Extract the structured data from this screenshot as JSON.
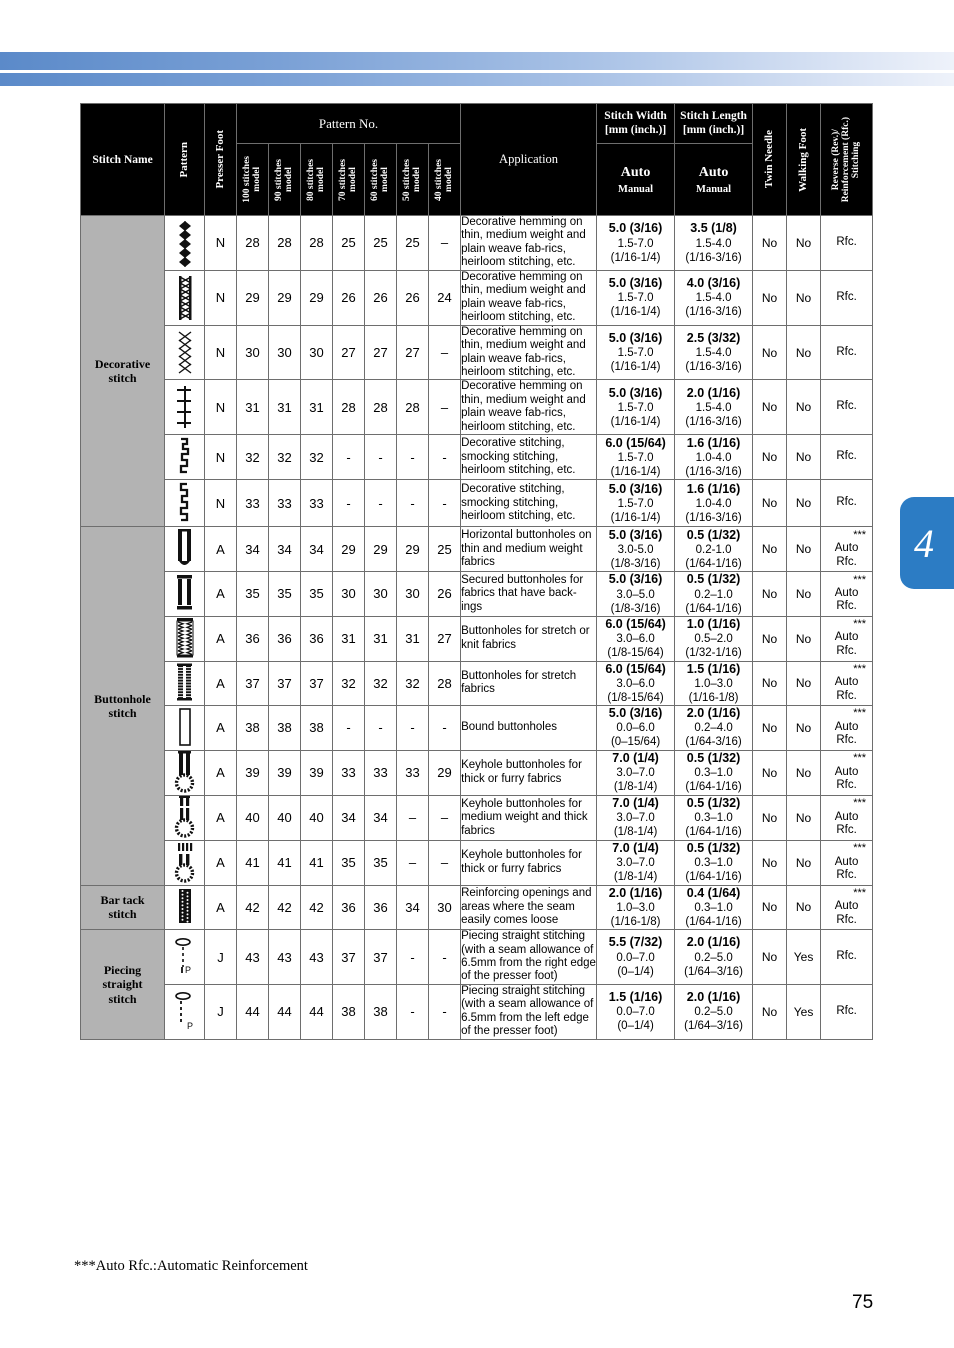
{
  "page": {
    "number": "75",
    "chapter_tab": "4",
    "footnote": "***Auto Rfc.:Automatic Reinforcement",
    "accent_color": "#2c7cc4",
    "header_bg": "#000000",
    "category_bg": "#b3b3b3"
  },
  "header": {
    "stitch_name": "Stitch Name",
    "pattern": "Pattern",
    "presser_foot": "Presser Foot",
    "pattern_no": "Pattern No.",
    "models": [
      "100 stitches\nmodel",
      "90 stitches\nmodel",
      "80 stitches\nmodel",
      "70 stitches\nmodel",
      "60 stitches\nmodel",
      "50 stitches\nmodel",
      "40 stitches\nmodel"
    ],
    "application": "Application",
    "stitch_width": "Stitch Width\n[mm (inch.)]",
    "stitch_length": "Stitch Length\n[mm (inch.)]",
    "auto": "Auto",
    "manual": "Manual",
    "twin_needle": "Twin Needle",
    "walking_foot": "Walking Foot",
    "reverse": "Reverse (Rev.)/\nReinforcement (Rfc.)\nStitching"
  },
  "categories": [
    {
      "name": "Decorative\nstitch",
      "rows": 6
    },
    {
      "name": "Buttonhole\nstitch",
      "rows": 8
    },
    {
      "name": "Bar tack\nstitch",
      "rows": 1
    },
    {
      "name": "Piecing\nstraight\nstitch",
      "rows": 2
    }
  ],
  "rows": [
    {
      "pattern_icon": "decorative-diamond-chain-stitch-icon",
      "presser_foot": "N",
      "numbers": [
        "28",
        "28",
        "28",
        "25",
        "25",
        "25",
        "–"
      ],
      "application": "Decorative hemming on thin, medium weight and plain weave fab-rics, heirloom stitching, etc.",
      "width_auto": "5.0 (3/16)",
      "width_range": "1.5-7.0",
      "width_inch": "(1/16-1/4)",
      "length_auto": "3.5 (1/8)",
      "length_range": "1.5-4.0",
      "length_inch": "(1/16-3/16)",
      "twin_needle": "No",
      "walking_foot": "No",
      "reverse": "Rfc.",
      "stars": ""
    },
    {
      "pattern_icon": "decorative-ladder-zigzag-stitch-icon",
      "presser_foot": "N",
      "numbers": [
        "29",
        "29",
        "29",
        "26",
        "26",
        "26",
        "24"
      ],
      "application": "Decorative hemming on thin, medium weight and plain weave fab-rics, heirloom stitching, etc.",
      "width_auto": "5.0 (3/16)",
      "width_range": "1.5-7.0",
      "width_inch": "(1/16-1/4)",
      "length_auto": "4.0 (3/16)",
      "length_range": "1.5-4.0",
      "length_inch": "(1/16-3/16)",
      "twin_needle": "No",
      "walking_foot": "No",
      "reverse": "Rfc.",
      "stars": ""
    },
    {
      "pattern_icon": "decorative-crosshatch-stitch-icon",
      "presser_foot": "N",
      "numbers": [
        "30",
        "30",
        "30",
        "27",
        "27",
        "27",
        "–"
      ],
      "application": "Decorative hemming on thin, medium weight and plain weave fab-rics, heirloom stitching, etc.",
      "width_auto": "5.0 (3/16)",
      "width_range": "1.5-7.0",
      "width_inch": "(1/16-1/4)",
      "length_auto": "2.5 (3/32)",
      "length_range": "1.5-4.0",
      "length_inch": "(1/16-3/16)",
      "twin_needle": "No",
      "walking_foot": "No",
      "reverse": "Rfc.",
      "stars": ""
    },
    {
      "pattern_icon": "decorative-crossbar-stitch-icon",
      "presser_foot": "N",
      "numbers": [
        "31",
        "31",
        "31",
        "28",
        "28",
        "28",
        "–"
      ],
      "application": "Decorative hemming on thin, medium weight and plain weave fab-rics, heirloom stitching, etc.",
      "width_auto": "5.0 (3/16)",
      "width_range": "1.5-7.0",
      "width_inch": "(1/16-1/4)",
      "length_auto": "2.0 (1/16)",
      "length_range": "1.5-4.0",
      "length_inch": "(1/16-3/16)",
      "twin_needle": "No",
      "walking_foot": "No",
      "reverse": "Rfc.",
      "stars": ""
    },
    {
      "pattern_icon": "decorative-step-wave-stitch-icon",
      "presser_foot": "N",
      "numbers": [
        "32",
        "32",
        "32",
        "-",
        "-",
        "-",
        "-"
      ],
      "application": "Decorative stitching, smocking stitching, heirloom stitching, etc.",
      "width_auto": "6.0 (15/64)",
      "width_range": "1.5-7.0",
      "width_inch": "(1/16-1/4)",
      "length_auto": "1.6 (1/16)",
      "length_range": "1.0-4.0",
      "length_inch": "(1/16-3/16)",
      "twin_needle": "No",
      "walking_foot": "No",
      "reverse": "Rfc.",
      "stars": ""
    },
    {
      "pattern_icon": "decorative-step-wave-alt-stitch-icon",
      "presser_foot": "N",
      "numbers": [
        "33",
        "33",
        "33",
        "-",
        "-",
        "-",
        "-"
      ],
      "application": "Decorative stitching, smocking stitching, heirloom stitching, etc.",
      "width_auto": "5.0 (3/16)",
      "width_range": "1.5-7.0",
      "width_inch": "(1/16-1/4)",
      "length_auto": "1.6 (1/16)",
      "length_range": "1.0-4.0",
      "length_inch": "(1/16-3/16)",
      "twin_needle": "No",
      "walking_foot": "No",
      "reverse": "Rfc.",
      "stars": ""
    },
    {
      "pattern_icon": "horizontal-buttonhole-icon",
      "presser_foot": "A",
      "numbers": [
        "34",
        "34",
        "34",
        "29",
        "29",
        "29",
        "25"
      ],
      "application": "Horizontal buttonholes on thin and medium weight fabrics",
      "width_auto": "5.0 (3/16)",
      "width_range": "3.0-5.0",
      "width_inch": "(1/8-3/16)",
      "length_auto": "0.5 (1/32)",
      "length_range": "0.2-1.0",
      "length_inch": "(1/64-1/16)",
      "twin_needle": "No",
      "walking_foot": "No",
      "reverse": "Auto\nRfc.",
      "stars": "***"
    },
    {
      "pattern_icon": "secured-buttonhole-icon",
      "presser_foot": "A",
      "numbers": [
        "35",
        "35",
        "35",
        "30",
        "30",
        "30",
        "26"
      ],
      "application": "Secured buttonholes for fabrics that have back-ings",
      "width_auto": "5.0 (3/16)",
      "width_range": "3.0–5.0",
      "width_inch": "(1/8-3/16)",
      "length_auto": "0.5 (1/32)",
      "length_range": "0.2–1.0",
      "length_inch": "(1/64-1/16)",
      "twin_needle": "No",
      "walking_foot": "No",
      "reverse": "Auto\nRfc.",
      "stars": "***"
    },
    {
      "pattern_icon": "stretch-buttonhole-icon",
      "presser_foot": "A",
      "numbers": [
        "36",
        "36",
        "36",
        "31",
        "31",
        "31",
        "27"
      ],
      "application": "Buttonholes for stretch or knit fabrics",
      "width_auto": "6.0 (15/64)",
      "width_range": "3.0–6.0",
      "width_inch": "(1/8-15/64)",
      "length_auto": "1.0 (1/16)",
      "length_range": "0.5–2.0",
      "length_inch": "(1/32-1/16)",
      "twin_needle": "No",
      "walking_foot": "No",
      "reverse": "Auto\nRfc.",
      "stars": "***"
    },
    {
      "pattern_icon": "stretch-fabric-buttonhole-icon",
      "presser_foot": "A",
      "numbers": [
        "37",
        "37",
        "37",
        "32",
        "32",
        "32",
        "28"
      ],
      "application": "Buttonholes for stretch fabrics",
      "width_auto": "6.0 (15/64)",
      "width_range": "3.0–6.0",
      "width_inch": "(1/8-15/64)",
      "length_auto": "1.5 (1/16)",
      "length_range": "1.0–3.0",
      "length_inch": "(1/16-1/8)",
      "twin_needle": "No",
      "walking_foot": "No",
      "reverse": "Auto\nRfc.",
      "stars": "***"
    },
    {
      "pattern_icon": "bound-buttonhole-icon",
      "presser_foot": "A",
      "numbers": [
        "38",
        "38",
        "38",
        "-",
        "-",
        "-",
        "-"
      ],
      "application": "Bound buttonholes",
      "width_auto": "5.0 (3/16)",
      "width_range": "0.0–6.0",
      "width_inch": "(0–15/64)",
      "length_auto": "2.0 (1/16)",
      "length_range": "0.2–4.0",
      "length_inch": "(1/64-3/16)",
      "twin_needle": "No",
      "walking_foot": "No",
      "reverse": "Auto\nRfc.",
      "stars": "***"
    },
    {
      "pattern_icon": "keyhole-buttonhole-thick-icon",
      "presser_foot": "A",
      "numbers": [
        "39",
        "39",
        "39",
        "33",
        "33",
        "33",
        "29"
      ],
      "application": "Keyhole buttonholes for thick or furry fabrics",
      "width_auto": "7.0 (1/4)",
      "width_range": "3.0–7.0",
      "width_inch": "(1/8-1/4)",
      "length_auto": "0.5 (1/32)",
      "length_range": "0.3–1.0",
      "length_inch": "(1/64-1/16)",
      "twin_needle": "No",
      "walking_foot": "No",
      "reverse": "Auto\nRfc.",
      "stars": "***"
    },
    {
      "pattern_icon": "keyhole-buttonhole-medium-icon",
      "presser_foot": "A",
      "numbers": [
        "40",
        "40",
        "40",
        "34",
        "34",
        "–",
        "–"
      ],
      "application": "Keyhole buttonholes for medium weight and thick fabrics",
      "width_auto": "7.0 (1/4)",
      "width_range": "3.0–7.0",
      "width_inch": "(1/8-1/4)",
      "length_auto": "0.5 (1/32)",
      "length_range": "0.3–1.0",
      "length_inch": "(1/64-1/16)",
      "twin_needle": "No",
      "walking_foot": "No",
      "reverse": "Auto\nRfc.",
      "stars": "***"
    },
    {
      "pattern_icon": "keyhole-buttonhole-furry-icon",
      "presser_foot": "A",
      "numbers": [
        "41",
        "41",
        "41",
        "35",
        "35",
        "–",
        "–"
      ],
      "application": "Keyhole buttonholes for thick or furry fabrics",
      "width_auto": "7.0 (1/4)",
      "width_range": "3.0–7.0",
      "width_inch": "(1/8-1/4)",
      "length_auto": "0.5 (1/32)",
      "length_range": "0.3–1.0",
      "length_inch": "(1/64-1/16)",
      "twin_needle": "No",
      "walking_foot": "No",
      "reverse": "Auto\nRfc.",
      "stars": "***"
    },
    {
      "pattern_icon": "bar-tack-icon",
      "presser_foot": "A",
      "numbers": [
        "42",
        "42",
        "42",
        "36",
        "36",
        "34",
        "30"
      ],
      "application": "Reinforcing openings and areas where the seam easily comes loose",
      "width_auto": "2.0 (1/16)",
      "width_range": "1.0–3.0",
      "width_inch": "(1/16-1/8)",
      "length_auto": "0.4 (1/64)",
      "length_range": "0.3–1.0",
      "length_inch": "(1/64-1/16)",
      "twin_needle": "No",
      "walking_foot": "No",
      "reverse": "Auto\nRfc.",
      "stars": "***"
    },
    {
      "pattern_icon": "piecing-straight-right-icon",
      "presser_foot": "J",
      "numbers": [
        "43",
        "43",
        "43",
        "37",
        "37",
        "-",
        "-"
      ],
      "application": "Piecing straight stitching (with a seam allowance of 6.5mm from the right edge of the presser foot)",
      "width_auto": "5.5 (7/32)",
      "width_range": "0.0–7.0",
      "width_inch": "(0–1/4)",
      "length_auto": "2.0 (1/16)",
      "length_range": "0.2–5.0",
      "length_inch": "(1/64–3/16)",
      "twin_needle": "No",
      "walking_foot": "Yes",
      "reverse": "Rfc.",
      "stars": ""
    },
    {
      "pattern_icon": "piecing-straight-left-icon",
      "presser_foot": "J",
      "numbers": [
        "44",
        "44",
        "44",
        "38",
        "38",
        "-",
        "-"
      ],
      "application": "Piecing straight stitching (with a seam allowance of 6.5mm from the left edge of the presser foot)",
      "width_auto": "1.5 (1/16)",
      "width_range": "0.0–7.0",
      "width_inch": "(0–1/4)",
      "length_auto": "2.0 (1/16)",
      "length_range": "0.2–5.0",
      "length_inch": "(1/64–3/16)",
      "twin_needle": "No",
      "walking_foot": "Yes",
      "reverse": "Rfc.",
      "stars": ""
    }
  ]
}
